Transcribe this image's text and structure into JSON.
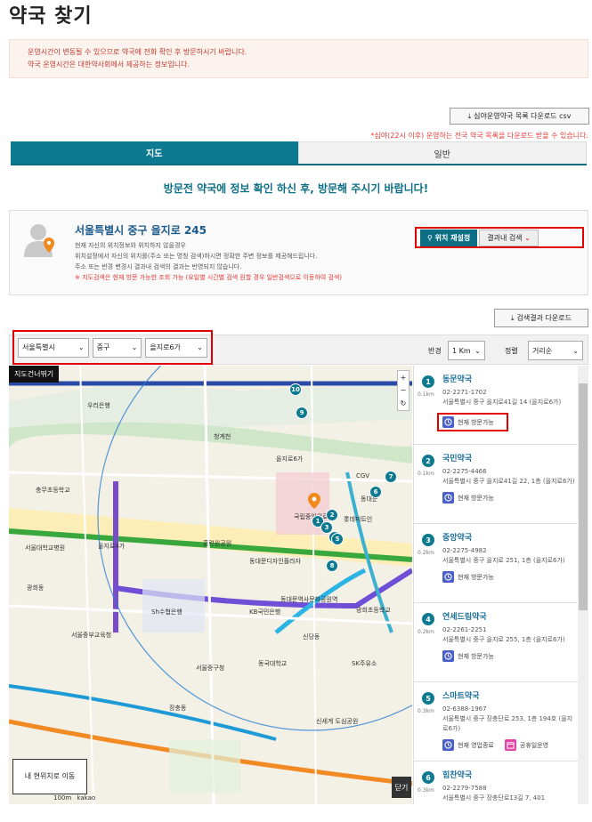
{
  "page_title": "약국 찾기",
  "notice": {
    "line1": "운영시간이 변동될 수 있으므로 약국에 전화 확인 후 방문하시기 바랍니다.",
    "line2": "약국 운영시간은 대한약사회에서 제공하는 정보입니다."
  },
  "csv_button": "심야운영약국 목록 다운로드 csv",
  "csv_note": "*심야(22시 이후) 운영하는 전국 약국 목록을 다운로드 받을 수 있습니다.",
  "tabs": [
    {
      "label": "지도",
      "active": true
    },
    {
      "label": "일반",
      "active": false
    }
  ],
  "headline": "방문전 약국에 정보 확인 하신 후, 방문해 주시기 바랍니다!",
  "location": {
    "address": "서울특별시 중구 을지로 245",
    "desc1": "현재 자신의 위치정보와 위치하지 않을경우",
    "desc2": "위치설정에서 자신의 위치를(주소 또는 명칭 검색)하시면 정확한 주변 정보를 제공해드립니다.",
    "desc3": "주소 또는 반경 변경시 결과내 검색의 결과는 반영되지 않습니다.",
    "desc4": "※ 지도검색은 현재 방문 가능한 조회 가능 (요일별 시간별 검색 원할 경우 일반검색으로 이동하여 검색)",
    "locate_button": "위치 재설정",
    "search_button": "결과내 검색"
  },
  "download_button": "검색결과 다운로드",
  "filters": {
    "city": "서울특별시",
    "district": "중구",
    "dong": "을지로6가",
    "radius_label": "반경",
    "radius": "1 Km",
    "sort_label": "정렬",
    "sort": "거리순"
  },
  "map": {
    "view_button": "지도건너뛰기",
    "current_location_button": "내 현위치로 이동",
    "close_button": "닫기",
    "scale": "100m",
    "provider": "kakao",
    "labels": [
      "우리은행",
      "충무초등학교",
      "을지로6가",
      "을지로4가",
      "동대문",
      "국립중앙의료원",
      "롯데피트인",
      "청계천",
      "동대문디자인플라자",
      "장충동",
      "신당동",
      "광희동",
      "KB국민은행",
      "Sh수협은행",
      "서울중부교육청",
      "서울중구청",
      "동대문역사문화공원역",
      "훈련원공원",
      "동국대학교",
      "SK주유소",
      "CGV",
      "서울대학교병원",
      "광희초등학교",
      "신세계 도심공원"
    ],
    "markers": [
      "1",
      "2",
      "3",
      "4",
      "5",
      "6",
      "7",
      "8",
      "9",
      "10"
    ]
  },
  "pharmacies": [
    {
      "num": "1",
      "dist": "0.1km",
      "name": "동문약국",
      "phone": "02-2271-1702",
      "addr": "서울특별시 중구 을지로41길 14 (을지로6가)",
      "status": "현재 방문가능",
      "holiday": ""
    },
    {
      "num": "2",
      "dist": "0.1km",
      "name": "국민약국",
      "phone": "02-2275-4466",
      "addr": "서울특별시 중구 을지로41길 22, 1층 (을지로6가)",
      "status": "현재 방문가능",
      "holiday": ""
    },
    {
      "num": "3",
      "dist": "0.2km",
      "name": "중앙약국",
      "phone": "02-2275-4982",
      "addr": "서울특별시 중구 을지로 251, 1층 (을지로6가)",
      "status": "현재 방문가능",
      "holiday": ""
    },
    {
      "num": "4",
      "dist": "0.2km",
      "name": "연세드림약국",
      "phone": "02-2261-2251",
      "addr": "서울특별시 중구 을지로 255, 1층 (을지로6가)",
      "status": "현재 방문가능",
      "holiday": ""
    },
    {
      "num": "5",
      "dist": "0.3km",
      "name": "스마트약국",
      "phone": "02-6388-1967",
      "addr": "서울특별시 중구 장충단로 253, 1층 194호 (을지로6가)",
      "status": "현재 영업종료",
      "holiday": "공휴일운영"
    },
    {
      "num": "6",
      "dist": "0.3km",
      "name": "힘찬약국",
      "phone": "02-2279-7588",
      "addr": "서울특별시 중구 장충단로13길 7, 401",
      "status": "",
      "holiday": ""
    }
  ]
}
